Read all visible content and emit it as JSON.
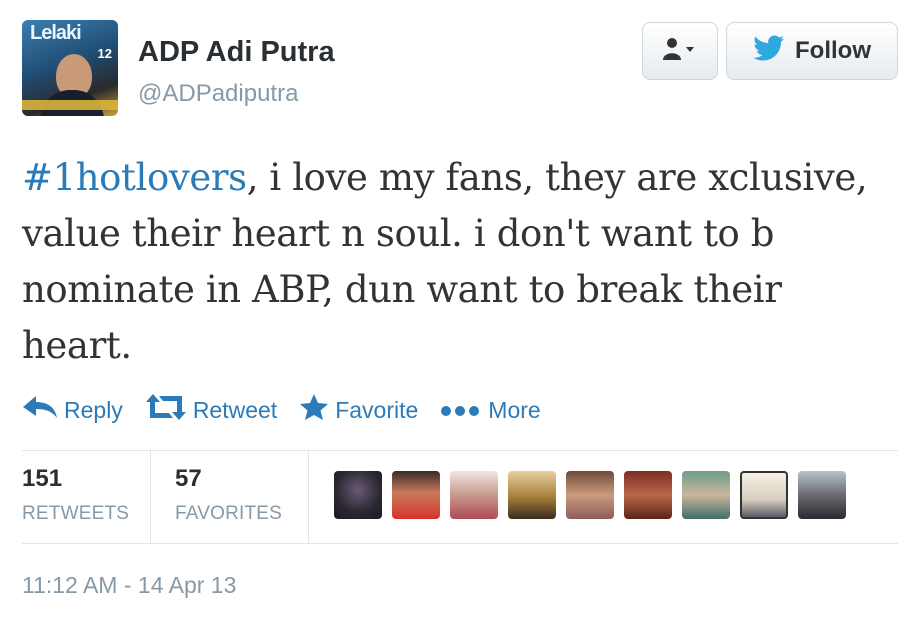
{
  "header": {
    "display_name": "ADP Adi Putra",
    "handle": "@ADPadiputra",
    "avatar": {
      "magazine_title": "Lelaki",
      "issue_number": "12"
    }
  },
  "buttons": {
    "user_menu_icon": "user-dropdown-icon",
    "follow_icon": "twitter-bird-icon",
    "follow_label": "Follow"
  },
  "tweet": {
    "hashtag": "#1hotlovers",
    "text": ", i love my fans, they are xclusive, value their heart n soul. i don't want to b nominate in ABP, dun want to break their heart."
  },
  "actions": [
    {
      "icon": "reply-arrow-icon",
      "label": "Reply"
    },
    {
      "icon": "retweet-icon",
      "label": "Retweet"
    },
    {
      "icon": "star-icon",
      "label": "Favorite"
    },
    {
      "icon": "more-dots-icon",
      "label": "More"
    }
  ],
  "stats": {
    "retweets_count": "151",
    "retweets_label": "RETWEETS",
    "favorites_count": "57",
    "favorites_label": "FAVORITES"
  },
  "favoriters": [
    {
      "name": "favoriter-avatar-1"
    },
    {
      "name": "favoriter-avatar-2"
    },
    {
      "name": "favoriter-avatar-3"
    },
    {
      "name": "favoriter-avatar-4"
    },
    {
      "name": "favoriter-avatar-5"
    },
    {
      "name": "favoriter-avatar-6"
    },
    {
      "name": "favoriter-avatar-7"
    },
    {
      "name": "favoriter-avatar-8"
    },
    {
      "name": "favoriter-avatar-9"
    }
  ],
  "timestamp": "11:12 AM - 14 Apr 13",
  "colors": {
    "link": "#2b7bb9",
    "muted": "#8899a6",
    "text": "#333333",
    "border": "#e1e8ed"
  }
}
